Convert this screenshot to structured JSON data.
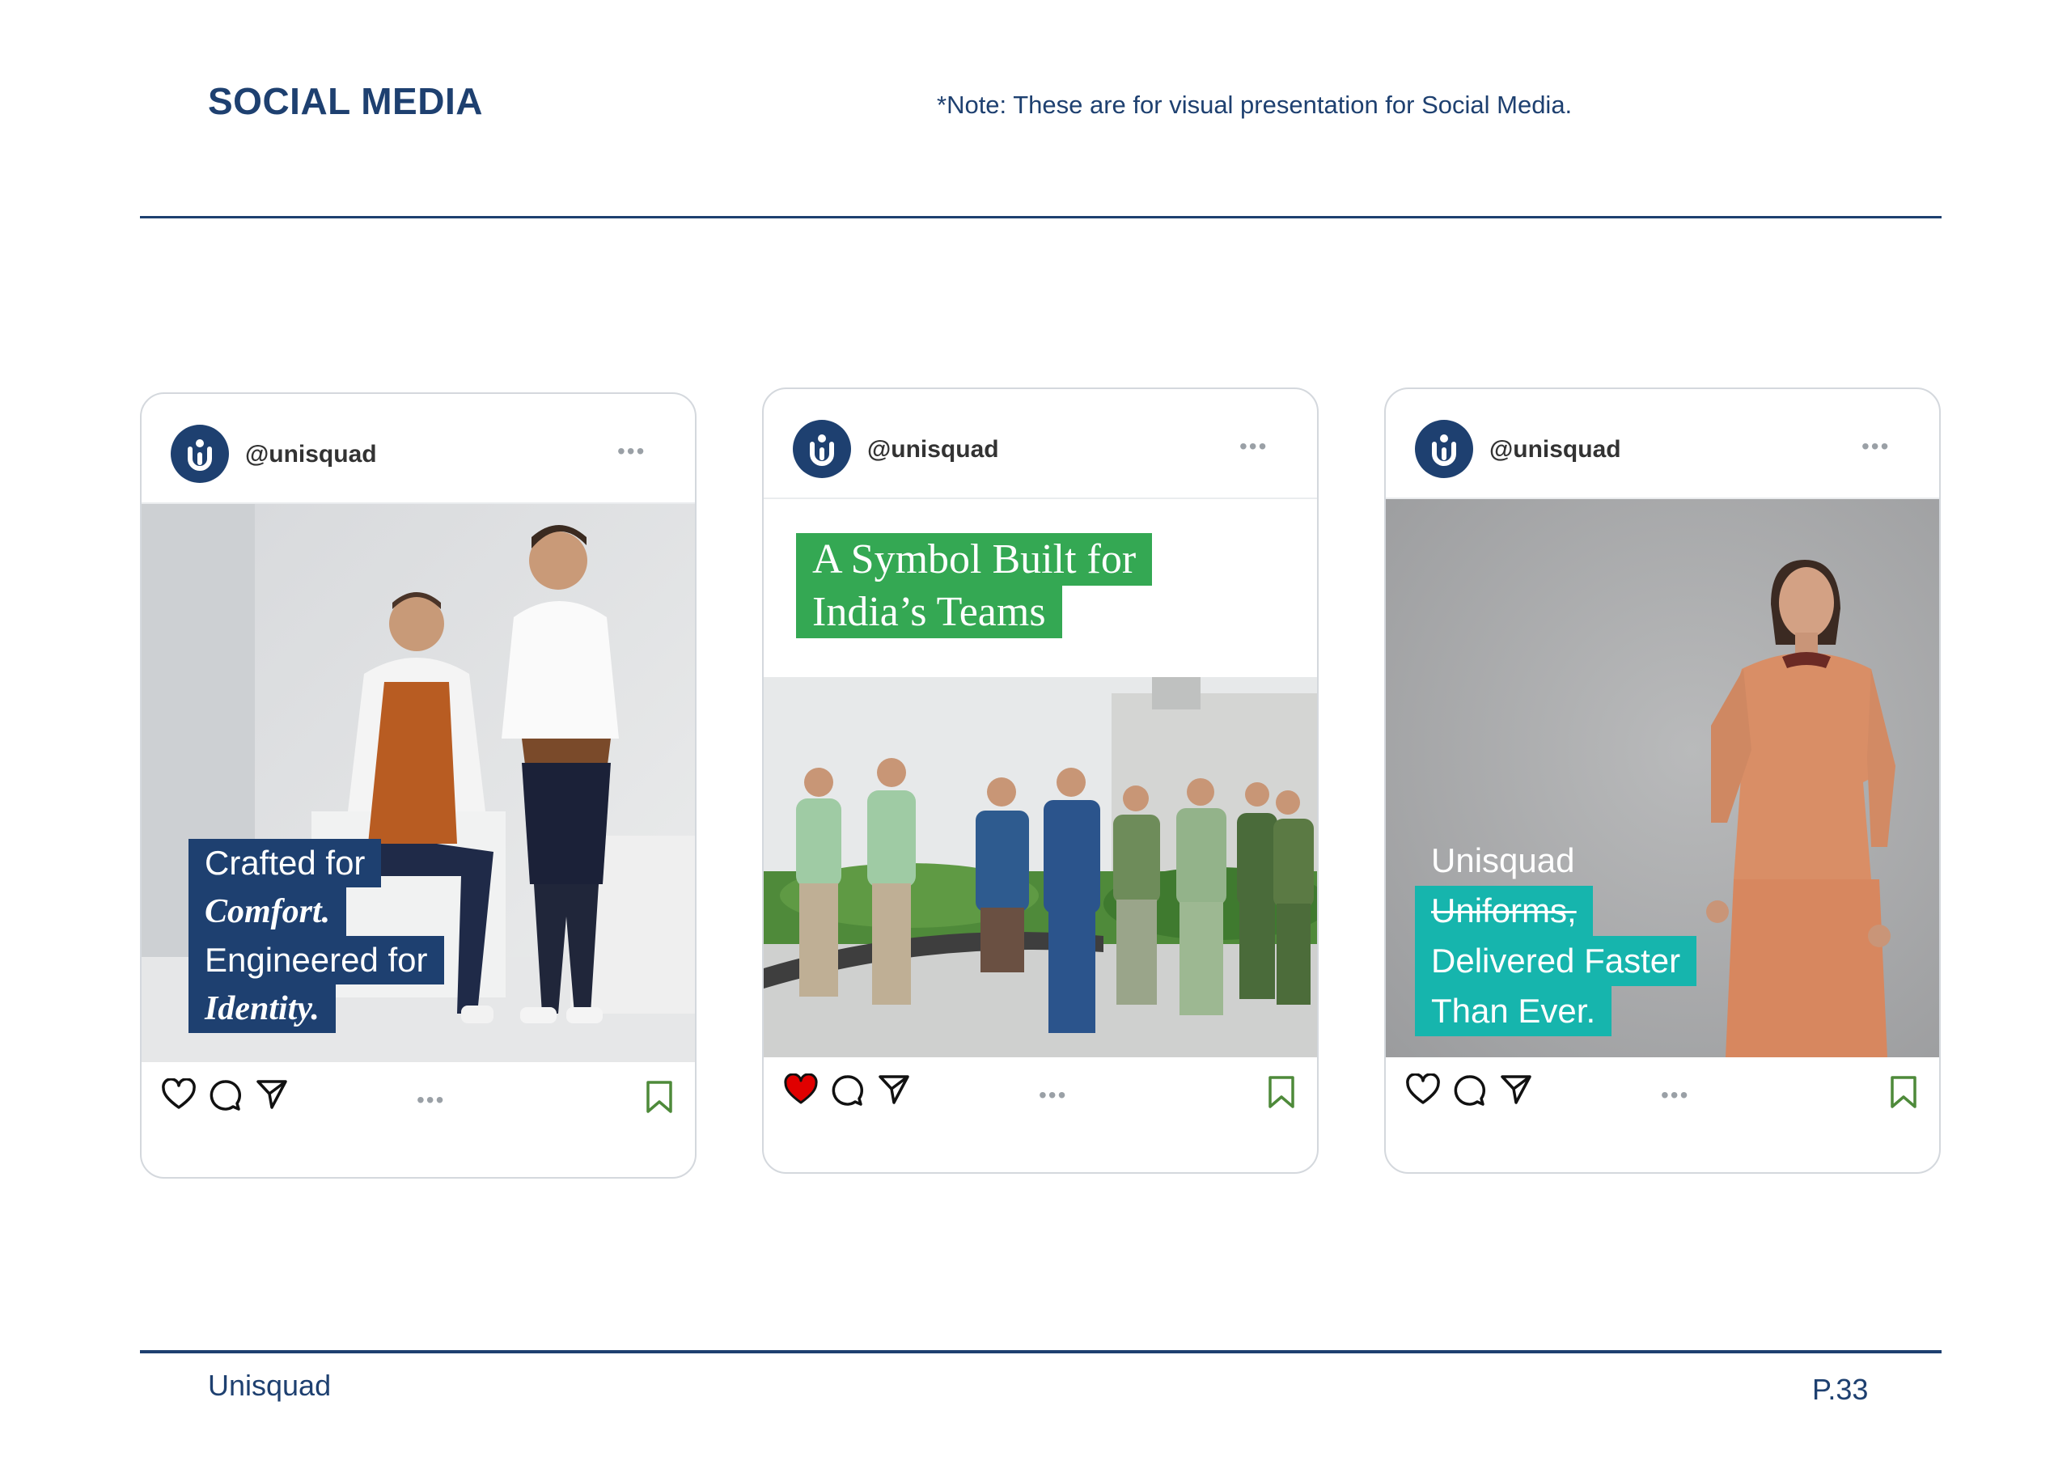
{
  "page": {
    "title": "SOCIAL MEDIA",
    "note": "*Note: These are for visual presentation for Social Media.",
    "footer_brand": "Unisquad",
    "page_number": "P.33"
  },
  "colors": {
    "brand_navy": "#1e4070",
    "green_tag": "#34a853",
    "teal_tag": "#16b5ad",
    "like_red": "#e00000",
    "bookmark_green": "#4e8a3a"
  },
  "posts": [
    {
      "handle": "@unisquad",
      "more": "•••",
      "caption_lines": [
        "Crafted for",
        "Comfort.",
        "Engineered for",
        "Identity."
      ],
      "liked": false,
      "photo": "two chefs in aprons and white chef jackets"
    },
    {
      "handle": "@unisquad",
      "more": "•••",
      "caption_lines": [
        "A Symbol Built for",
        "India’s Teams"
      ],
      "liked": true,
      "photo": "group of uniformed team members on a terrace"
    },
    {
      "handle": "@unisquad",
      "more": "•••",
      "caption_lines": [
        "Unisquad",
        "Uniforms,",
        "Delivered Faster",
        "Than Ever."
      ],
      "liked": false,
      "photo": "woman in orange tunic uniform"
    }
  ],
  "icons": [
    "avatar-logo-icon",
    "heart-icon",
    "comment-icon",
    "send-icon",
    "bookmark-icon",
    "more-icon"
  ]
}
